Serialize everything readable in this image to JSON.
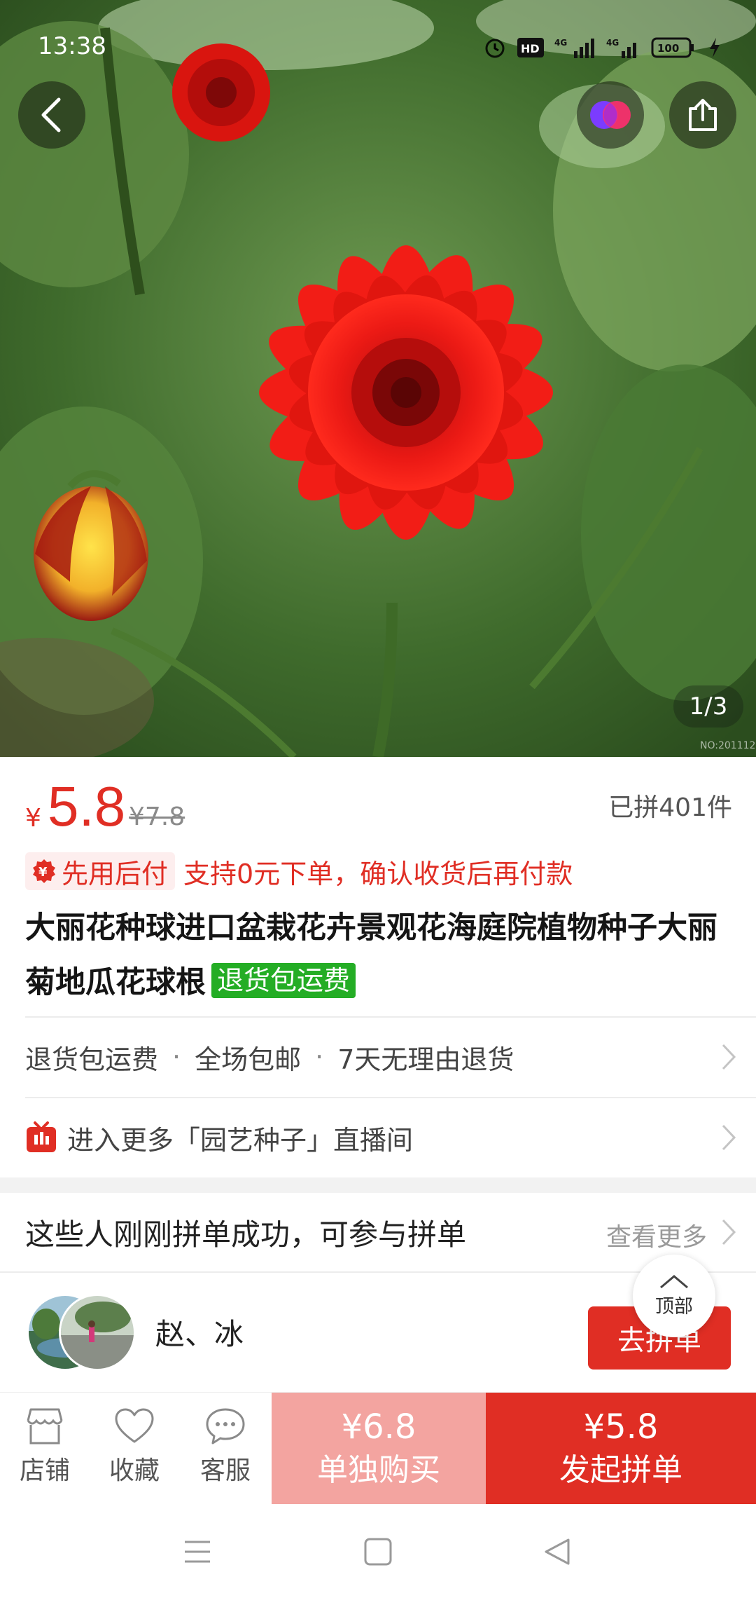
{
  "status_bar": {
    "time": "13:38",
    "battery": "100"
  },
  "gallery": {
    "indicator": "1/3"
  },
  "price": {
    "symbol": "¥",
    "current": "5.8",
    "original": "¥7.8",
    "sold": "已拼401件"
  },
  "payment": {
    "badge": "先用后付",
    "desc": "支持0元下单，确认收货后再付款"
  },
  "product": {
    "title": "大丽花种球进口盆栽花卉景观花海庭院植物种子大丽菊地瓜花球根",
    "tag": "退货包运费"
  },
  "services": {
    "items": [
      "退货包运费",
      "全场包邮",
      "7天无理由退货"
    ],
    "separator": "·"
  },
  "live": {
    "label": "进入更多「园艺种子」直播间"
  },
  "group_section": {
    "title": "这些人刚刚拼单成功，可参与拼单",
    "see_more": "查看更多",
    "members": "赵、冰",
    "join_label": "去拼单"
  },
  "back_to_top": "顶部",
  "bottom_nav": {
    "shop": "店铺",
    "favorite": "收藏",
    "service": "客服"
  },
  "buy_alone": {
    "price": "¥6.8",
    "label": "单独购买"
  },
  "buy_group": {
    "price": "¥5.8",
    "label": "发起拼单"
  },
  "colors": {
    "accent": "#e02e24",
    "accent_light": "#f3a4a0",
    "tag_green": "#24ad25"
  }
}
